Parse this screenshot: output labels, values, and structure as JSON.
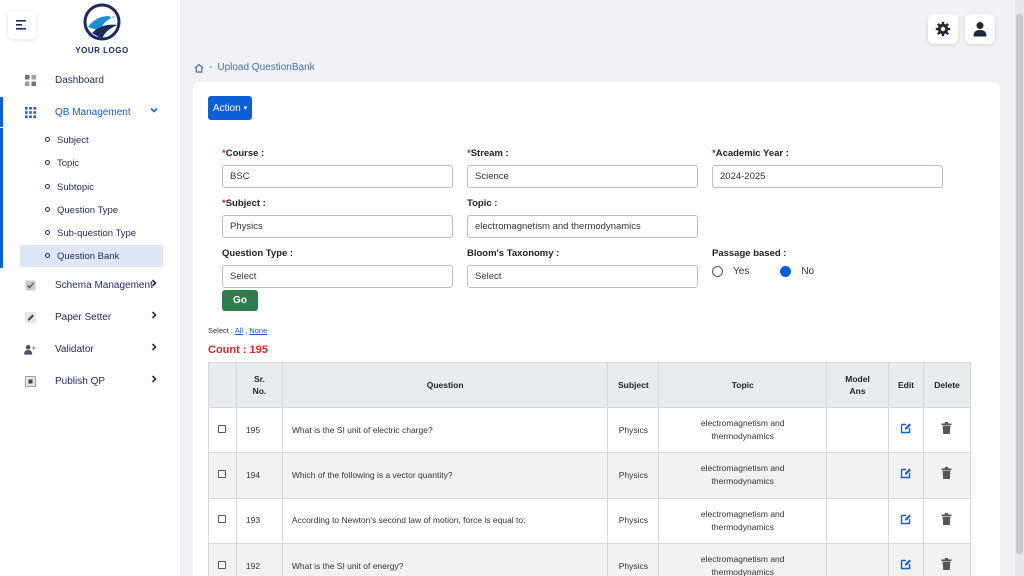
{
  "app": {
    "logo_text": "YOUR LOGO",
    "brand_color": "#0d5fd6"
  },
  "sidebar": {
    "items": [
      {
        "label": "Dashboard",
        "icon": "dashboard-icon"
      },
      {
        "label": "QB Management",
        "icon": "grid-icon",
        "expanded": true
      },
      {
        "label": "Schema Management",
        "icon": "checkbox-icon"
      },
      {
        "label": "Paper Setter",
        "icon": "pencil-icon"
      },
      {
        "label": "Validator",
        "icon": "user-plus-icon"
      },
      {
        "label": "Publish QP",
        "icon": "publish-icon"
      }
    ],
    "sub_items": [
      {
        "label": "Subject"
      },
      {
        "label": "Topic"
      },
      {
        "label": "Subtopic"
      },
      {
        "label": "Question Type"
      },
      {
        "label": "Sub-question Type"
      },
      {
        "label": "Question Bank",
        "selected": true
      }
    ]
  },
  "breadcrumb": {
    "separator": "-",
    "current": "Upload QuestionBank"
  },
  "toolbar": {
    "action_label": "Action"
  },
  "form": {
    "course": {
      "label": "Course :",
      "value": "BSC"
    },
    "stream": {
      "label": "Stream :",
      "value": "Science"
    },
    "academic_year": {
      "label": "Academic Year :",
      "value": "2024-2025"
    },
    "subject": {
      "label": "Subject :",
      "value": "Physics"
    },
    "topic": {
      "label": "Topic :",
      "value": "electromagnetism and thermodynamics"
    },
    "question_type": {
      "label": "Question Type :",
      "value": "Select"
    },
    "blooms": {
      "label": "Bloom's Taxonomy :",
      "value": "Select"
    },
    "passage": {
      "label": "Passage based :",
      "yes": "Yes",
      "no": "No",
      "selected": "No"
    },
    "go_label": "Go",
    "required_marker": "*"
  },
  "selection": {
    "prefix": "Select :",
    "all": "All",
    "comma": ",",
    "none": "None"
  },
  "count": {
    "text": "Count : 195"
  },
  "table": {
    "headers": {
      "srno_1": "Sr.",
      "srno_2": "No.",
      "question": "Question",
      "subject": "Subject",
      "topic": "Topic",
      "model_1": "Model",
      "model_2": "Ans",
      "edit": "Edit",
      "delete": "Delete"
    },
    "rows": [
      {
        "srno": "195",
        "question": "What is the SI unit of electric charge?",
        "subject": "Physics",
        "topic_1": "electromagnetism and",
        "topic_2": "thermodynamics"
      },
      {
        "srno": "194",
        "question": "Which of the following is a vector quantity?",
        "subject": "Physics",
        "topic_1": "electromagnetism and",
        "topic_2": "thermodynamics"
      },
      {
        "srno": "193",
        "question": "According to Newton's second law of motion, force is equal to:",
        "subject": "Physics",
        "topic_1": "electromagnetism and",
        "topic_2": "thermodynamics"
      },
      {
        "srno": "192",
        "question": "What is the SI unit of energy?",
        "subject": "Physics",
        "topic_1": "electromagnetism and",
        "topic_2": "thermodynamics"
      }
    ]
  }
}
